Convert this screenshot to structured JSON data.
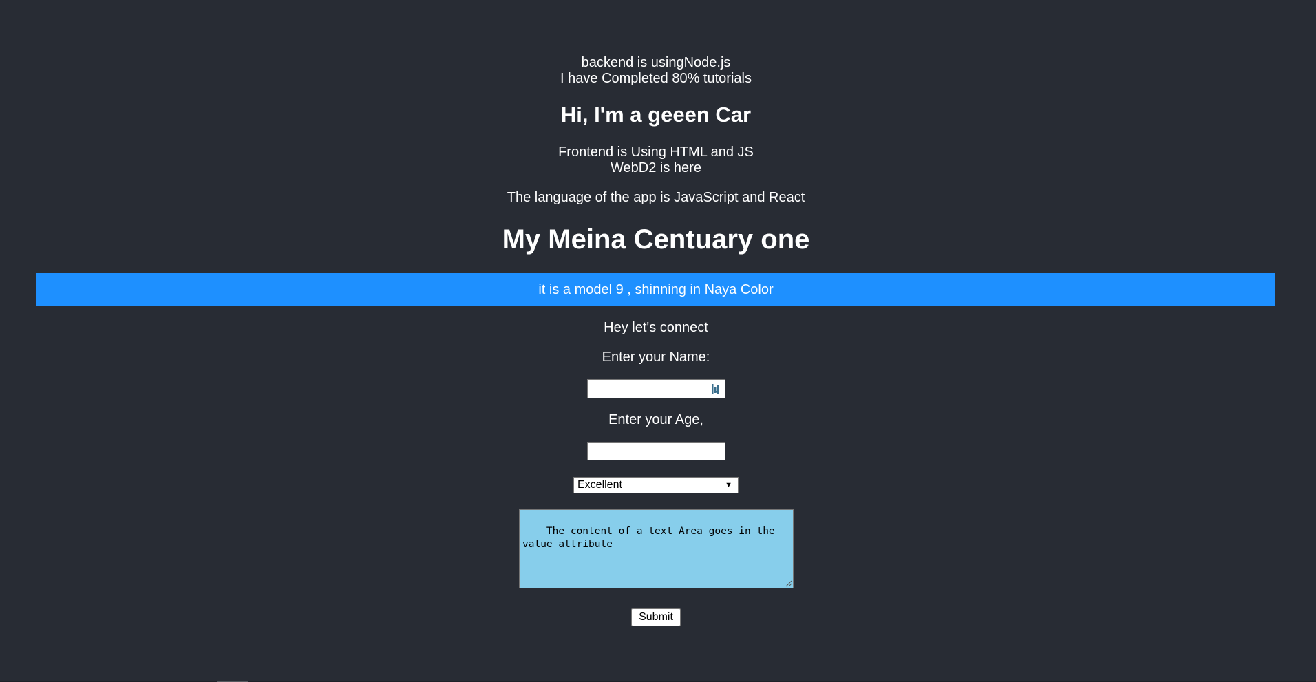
{
  "intro": {
    "backend_line": "backend is usingNode.js",
    "progress_line": "I have Completed 80% tutorials"
  },
  "car_heading": "Hi, I'm a geeen Car",
  "frontend": {
    "line1": "Frontend is Using HTML and JS",
    "line2": "WebD2 is here"
  },
  "language_line": "The language of the app is JavaScript and React",
  "main_heading": "My Meina Centuary one",
  "banner": {
    "text": "it is a model 9 , shinning in Naya Color",
    "background": "#1e90ff"
  },
  "form": {
    "intro": "Hey let's connect",
    "name_label": "Enter your Name:",
    "name_value": "",
    "age_label": "Enter your Age,",
    "age_value": "",
    "select_value": "Excellent",
    "textarea_value": "The content of a text Area goes in the value attribute",
    "textarea_background": "#87ceeb",
    "submit_label": "Submit"
  },
  "icons": {
    "name_field": "autofill-icon",
    "select": "chevron-down-icon",
    "textarea": "resize-grip-icon"
  },
  "colors": {
    "page_background": "#282c34",
    "text": "#ffffff"
  }
}
